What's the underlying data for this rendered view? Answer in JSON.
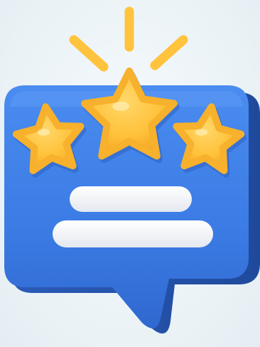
{
  "illustration": {
    "subject": "rating-speech-bubble",
    "icons": [
      "speech-bubble-icon",
      "star-icon",
      "star-icon",
      "star-icon",
      "sparkle-rays-icon",
      "text-lines"
    ],
    "rating": {
      "stars_filled": 3,
      "stars_total": 3
    },
    "colors": {
      "bubble": "#3d7fe6",
      "bubble_dark": "#2c63c7",
      "star": "#ffc53d",
      "star_dark": "#f5a522",
      "rays": "#ffc53d",
      "lines": "#f4f6fa",
      "background": "#eef4f7"
    }
  }
}
